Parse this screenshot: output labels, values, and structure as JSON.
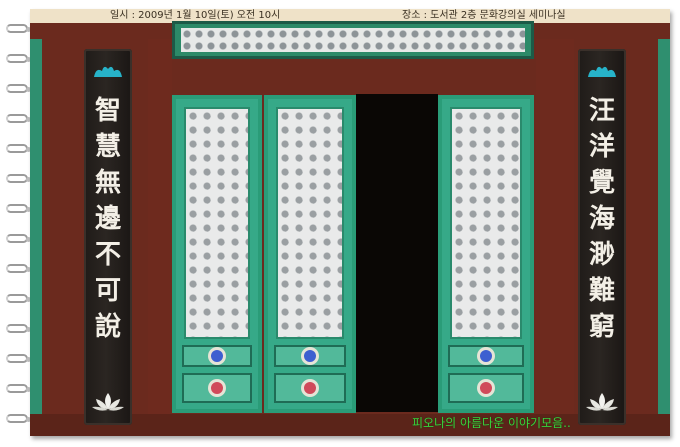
{
  "banner": {
    "left_text": "일시 : 2009년 1월 10일(토) 오전 10시",
    "right_text": "장소 : 도서관 2층 문화강의실 세미나실"
  },
  "plaque_left": {
    "lines": [
      "智",
      "慧",
      "無",
      "邊",
      "不",
      "可",
      "說"
    ],
    "cloud_icon": "cloud-icon",
    "lotus_icon": "lotus-icon"
  },
  "plaque_right": {
    "lines": [
      "汪",
      "洋",
      "覺",
      "海",
      "渺",
      "難",
      "窮"
    ],
    "cloud_icon": "cloud-icon",
    "lotus_icon": "lotus-icon"
  },
  "watermark": "피오나의 아름다운 이야기모음..",
  "colors": {
    "wood": "#6b2a1e",
    "celadon": "#36a988",
    "plaque": "#2b2622",
    "watermark": "#3cd03c"
  }
}
